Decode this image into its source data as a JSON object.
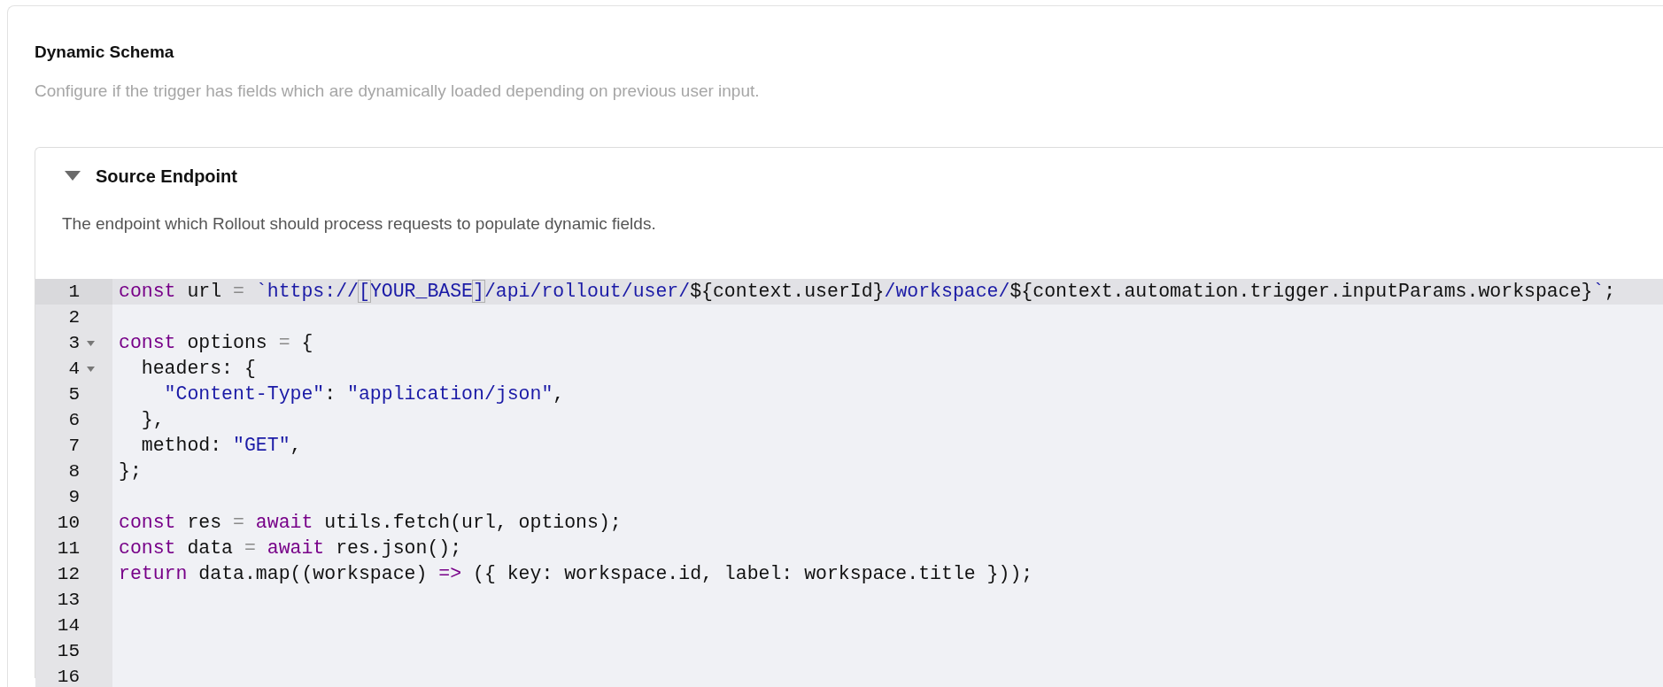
{
  "section": {
    "title": "Dynamic Schema",
    "description": "Configure if the trigger has fields which are dynamically loaded depending on previous user input."
  },
  "panel": {
    "title": "Source Endpoint",
    "expanded": true,
    "description": "The endpoint which Rollout should process requests to populate dynamic fields."
  },
  "editor": {
    "lines": [
      {
        "number": "1",
        "active": true,
        "fold": false,
        "tokens": [
          {
            "kind": "keyword",
            "text": "const"
          },
          {
            "kind": "plain",
            "text": " url "
          },
          {
            "kind": "operator",
            "text": "="
          },
          {
            "kind": "string",
            "text": " `https://"
          },
          {
            "kind": "bracket",
            "text": "["
          },
          {
            "kind": "string",
            "text": "YOUR_BASE"
          },
          {
            "kind": "bracket",
            "text": "]"
          },
          {
            "kind": "string",
            "text": "/api/rollout/user/"
          },
          {
            "kind": "plain",
            "text": "${context.userId}"
          },
          {
            "kind": "string",
            "text": "/workspace/"
          },
          {
            "kind": "plain",
            "text": "${context.automation.trigger.inputParams.workspace}"
          },
          {
            "kind": "string",
            "text": "`"
          },
          {
            "kind": "plain",
            "text": ";"
          }
        ]
      },
      {
        "number": "2",
        "active": false,
        "fold": false
      },
      {
        "number": "3",
        "active": false,
        "fold": true,
        "tokens": [
          {
            "kind": "keyword",
            "text": "const"
          },
          {
            "kind": "plain",
            "text": " options "
          },
          {
            "kind": "operator",
            "text": "="
          },
          {
            "kind": "plain",
            "text": " {"
          }
        ]
      },
      {
        "number": "4",
        "active": false,
        "fold": true,
        "tokens": [
          {
            "kind": "plain",
            "text": "  headers: {"
          }
        ]
      },
      {
        "number": "5",
        "active": false,
        "fold": false,
        "tokens": [
          {
            "kind": "string",
            "text": "    \"Content-Type\""
          },
          {
            "kind": "plain",
            "text": ": "
          },
          {
            "kind": "string",
            "text": "\"application/json\""
          },
          {
            "kind": "plain",
            "text": ","
          }
        ]
      },
      {
        "number": "6",
        "active": false,
        "fold": false,
        "tokens": [
          {
            "kind": "plain",
            "text": "  },"
          }
        ]
      },
      {
        "number": "7",
        "active": false,
        "fold": false,
        "tokens": [
          {
            "kind": "plain",
            "text": "  method: "
          },
          {
            "kind": "string",
            "text": "\"GET\""
          },
          {
            "kind": "plain",
            "text": ","
          }
        ]
      },
      {
        "number": "8",
        "active": false,
        "fold": false,
        "tokens": [
          {
            "kind": "plain",
            "text": "};"
          }
        ]
      },
      {
        "number": "9",
        "active": false,
        "fold": false
      },
      {
        "number": "10",
        "active": false,
        "fold": false,
        "tokens": [
          {
            "kind": "keyword",
            "text": "const"
          },
          {
            "kind": "plain",
            "text": " res "
          },
          {
            "kind": "operator",
            "text": "="
          },
          {
            "kind": "keyword",
            "text": " await"
          },
          {
            "kind": "plain",
            "text": " utils.fetch(url, options);"
          }
        ]
      },
      {
        "number": "11",
        "active": false,
        "fold": false,
        "tokens": [
          {
            "kind": "keyword",
            "text": "const"
          },
          {
            "kind": "plain",
            "text": " data "
          },
          {
            "kind": "operator",
            "text": "="
          },
          {
            "kind": "keyword",
            "text": " await"
          },
          {
            "kind": "plain",
            "text": " res.json();"
          }
        ]
      },
      {
        "number": "12",
        "active": false,
        "fold": false,
        "tokens": [
          {
            "kind": "keyword",
            "text": "return"
          },
          {
            "kind": "plain",
            "text": " data.map((workspace) "
          },
          {
            "kind": "keyword",
            "text": "=>"
          },
          {
            "kind": "plain",
            "text": " ({ key: workspace.id, label: workspace.title }));"
          }
        ]
      },
      {
        "number": "13",
        "active": false,
        "fold": false
      },
      {
        "number": "14",
        "active": false,
        "fold": false
      },
      {
        "number": "15",
        "active": false,
        "fold": false
      },
      {
        "number": "16",
        "active": false,
        "fold": false
      }
    ]
  }
}
